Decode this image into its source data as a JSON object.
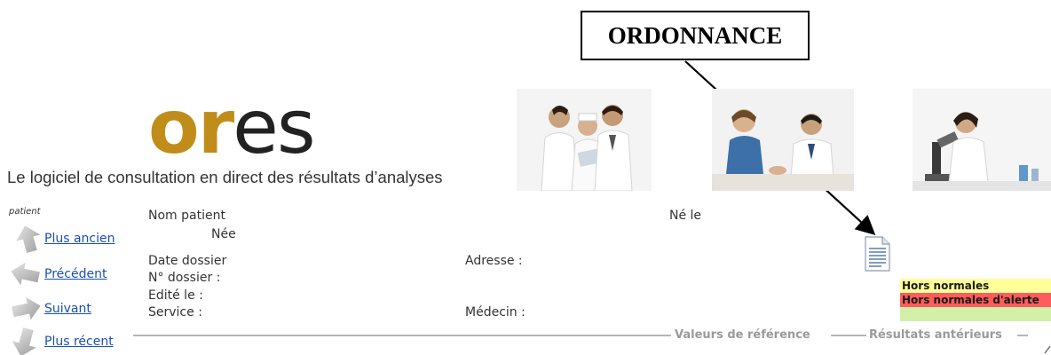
{
  "annotation": {
    "label": "ORDONNANCE"
  },
  "header": {
    "logo_strong": "or",
    "logo_light": "es",
    "tagline": "Le logiciel de consultation en direct des résultats d’analyses"
  },
  "nav": {
    "title": "patient",
    "items": [
      {
        "label": "Plus ancien",
        "icon": "arrow-up-icon"
      },
      {
        "label": "Précédent",
        "icon": "arrow-left-icon"
      },
      {
        "label": "Suivant",
        "icon": "arrow-right-icon"
      },
      {
        "label": "Plus récent",
        "icon": "arrow-down-icon"
      }
    ]
  },
  "patient": {
    "nom_label": "Nom patient",
    "nee_label": "Née",
    "ne_le_label": "Né le",
    "date_dossier_label": "Date dossier",
    "adresse_label": "Adresse :",
    "no_dossier_label": "N° dossier :",
    "edite_le_label": "Edité le :",
    "service_label": "Service :",
    "medecin_label": "Médecin :"
  },
  "legend": {
    "hors_normales": "Hors normales",
    "hors_normales_alerte": "Hors normales d'alerte",
    "colors": {
      "yellow": "#ffff99",
      "red": "#ff5c5c",
      "green": "#d2f0a8"
    }
  },
  "tabs": {
    "valeurs_reference": "Valeurs de référence",
    "resultats_anterieurs": "Résultats antérieurs"
  },
  "theme": {
    "logo_gold": "#c08d1a",
    "link_blue": "#1a4fb5"
  }
}
